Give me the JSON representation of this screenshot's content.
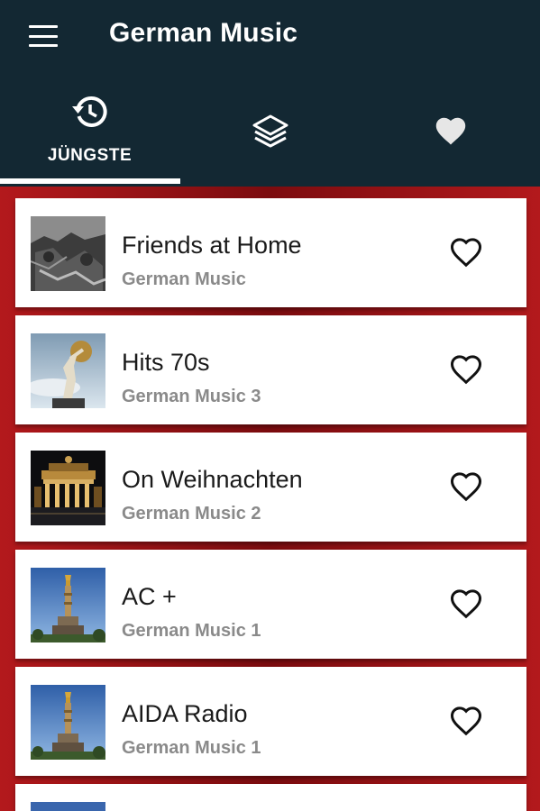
{
  "app": {
    "title": "German Music"
  },
  "tabs": [
    {
      "label": "JÜNGSTE",
      "icon": "history-icon",
      "active": true
    },
    {
      "label": "",
      "icon": "layers-icon",
      "active": false
    },
    {
      "label": "",
      "icon": "heart-icon",
      "active": false
    }
  ],
  "stations": [
    {
      "title": "Friends at Home",
      "subtitle": "German Music",
      "image": "bw-nature-photo"
    },
    {
      "title": "Hits 70s",
      "subtitle": "German Music 3",
      "image": "statue-sky-photo"
    },
    {
      "title": "On Weihnachten",
      "subtitle": "German Music 2",
      "image": "brandenburg-gate-photo"
    },
    {
      "title": "AC +",
      "subtitle": "German Music 1",
      "image": "victory-column-photo"
    },
    {
      "title": "AIDA Radio",
      "subtitle": "German Music 1",
      "image": "victory-column-photo"
    }
  ],
  "colors": {
    "appbar": "#132833",
    "list_bg": "#9a1216",
    "card": "#ffffff"
  }
}
